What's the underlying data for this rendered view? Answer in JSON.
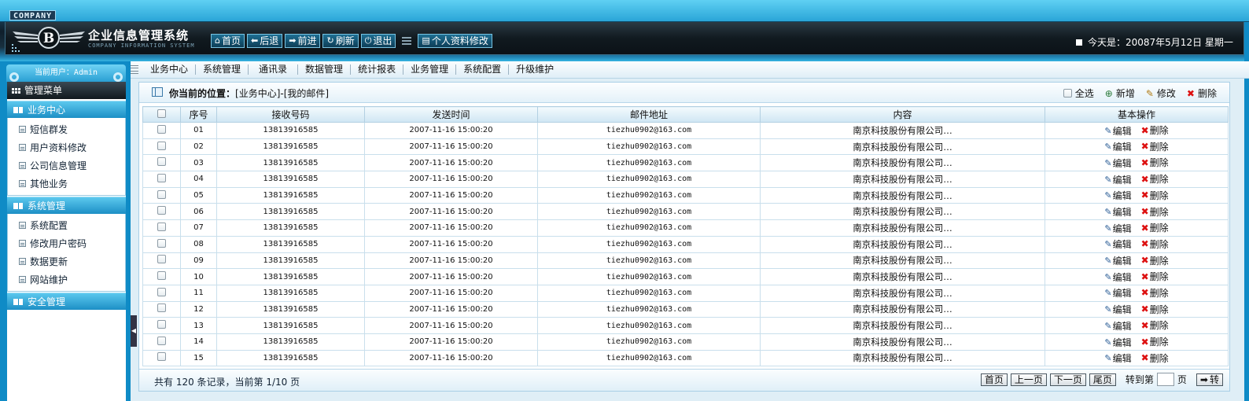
{
  "header": {
    "company_tag": "COMPANY",
    "title": "企业信息管理系统",
    "subtitle": "COMPANY INFORMATION SYSTEM",
    "logo_letter": "B",
    "nav": [
      {
        "label": "首页",
        "icon": "home-icon",
        "glyph": "⌂"
      },
      {
        "label": "后退",
        "icon": "back-arrow-icon",
        "glyph": "⬅"
      },
      {
        "label": "前进",
        "icon": "forward-arrow-icon",
        "glyph": "➡"
      },
      {
        "label": "刷新",
        "icon": "refresh-icon",
        "glyph": "↻"
      },
      {
        "label": "退出",
        "icon": "power-icon",
        "glyph": "⏻"
      }
    ],
    "profile_button": {
      "label": "个人资料修改",
      "icon": "profile-icon",
      "glyph": "▤"
    },
    "date_text": "今天是：20087年5月12日 星期一"
  },
  "sidebar": {
    "current_user": "当前用户：Admin",
    "menu_title": "管理菜单",
    "groups": [
      {
        "title": "业务中心",
        "items": [
          "短信群发",
          "用户资料修改",
          "公司信息管理",
          "其他业务"
        ]
      },
      {
        "title": "系统管理",
        "items": [
          "系统配置",
          "修改用户密码",
          "数据更新",
          "网站维护"
        ]
      },
      {
        "title": "安全管理",
        "items": []
      }
    ]
  },
  "tabs": [
    "业务中心",
    "系统管理",
    "通讯录",
    "数据管理",
    "统计报表",
    "业务管理",
    "系统配置",
    "升级维护"
  ],
  "panel": {
    "location_label": "你当前的位置：",
    "location_path": "[业务中心]-[我的邮件]",
    "ops": {
      "select_all": "全选",
      "add": "新增",
      "edit": "修改",
      "delete": "删除"
    },
    "columns": [
      "",
      "序号",
      "接收号码",
      "发送时间",
      "邮件地址",
      "内容",
      "基本操作"
    ],
    "row_actions": {
      "edit": "编辑",
      "delete": "删除"
    },
    "rows": [
      {
        "no": "01",
        "phone": "13813916585",
        "time": "2007-11-16 15:00:20",
        "email": "tiezhu0902@163.com",
        "content": "南京科技股份有限公司…"
      },
      {
        "no": "02",
        "phone": "13813916585",
        "time": "2007-11-16 15:00:20",
        "email": "tiezhu0902@163.com",
        "content": "南京科技股份有限公司…"
      },
      {
        "no": "03",
        "phone": "13813916585",
        "time": "2007-11-16 15:00:20",
        "email": "tiezhu0902@163.com",
        "content": "南京科技股份有限公司…"
      },
      {
        "no": "04",
        "phone": "13813916585",
        "time": "2007-11-16 15:00:20",
        "email": "tiezhu0902@163.com",
        "content": "南京科技股份有限公司…"
      },
      {
        "no": "05",
        "phone": "13813916585",
        "time": "2007-11-16 15:00:20",
        "email": "tiezhu0902@163.com",
        "content": "南京科技股份有限公司…"
      },
      {
        "no": "06",
        "phone": "13813916585",
        "time": "2007-11-16 15:00:20",
        "email": "tiezhu0902@163.com",
        "content": "南京科技股份有限公司…"
      },
      {
        "no": "07",
        "phone": "13813916585",
        "time": "2007-11-16 15:00:20",
        "email": "tiezhu0902@163.com",
        "content": "南京科技股份有限公司…"
      },
      {
        "no": "08",
        "phone": "13813916585",
        "time": "2007-11-16 15:00:20",
        "email": "tiezhu0902@163.com",
        "content": "南京科技股份有限公司…"
      },
      {
        "no": "09",
        "phone": "13813916585",
        "time": "2007-11-16 15:00:20",
        "email": "tiezhu0902@163.com",
        "content": "南京科技股份有限公司…"
      },
      {
        "no": "10",
        "phone": "13813916585",
        "time": "2007-11-16 15:00:20",
        "email": "tiezhu0902@163.com",
        "content": "南京科技股份有限公司…"
      },
      {
        "no": "11",
        "phone": "13813916585",
        "time": "2007-11-16 15:00:20",
        "email": "tiezhu0902@163.com",
        "content": "南京科技股份有限公司…"
      },
      {
        "no": "12",
        "phone": "13813916585",
        "time": "2007-11-16 15:00:20",
        "email": "tiezhu0902@163.com",
        "content": "南京科技股份有限公司…"
      },
      {
        "no": "13",
        "phone": "13813916585",
        "time": "2007-11-16 15:00:20",
        "email": "tiezhu0902@163.com",
        "content": "南京科技股份有限公司…"
      },
      {
        "no": "14",
        "phone": "13813916585",
        "time": "2007-11-16 15:00:20",
        "email": "tiezhu0902@163.com",
        "content": "南京科技股份有限公司…"
      },
      {
        "no": "15",
        "phone": "13813916585",
        "time": "2007-11-16 15:00:20",
        "email": "tiezhu0902@163.com",
        "content": "南京科技股份有限公司…"
      }
    ],
    "footer_info": "共有 120 条记录，当前第 1/10 页",
    "pager": {
      "first": "首页",
      "prev": "上一页",
      "next": "下一页",
      "last": "尾页",
      "goto_label": "转到第",
      "page_unit": "页",
      "go": "转"
    }
  },
  "colors": {
    "accent": "#0f8bc6",
    "header_dark": "#111a20",
    "delete_red": "#d11111"
  }
}
